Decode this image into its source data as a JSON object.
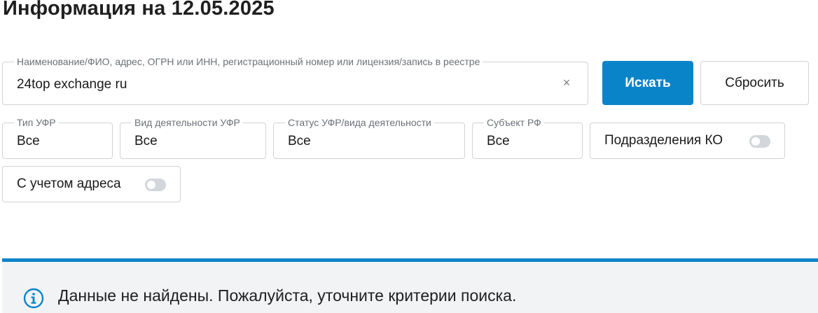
{
  "page": {
    "title": "Информация на 12.05.2025"
  },
  "search": {
    "label": "Наименование/ФИО, адрес, ОГРН или ИНН, регистрационный номер или лицензия/запись в реестре",
    "value": "24top exchange ru",
    "clear_symbol": "×",
    "search_button": "Искать",
    "reset_button": "Сбросить"
  },
  "filters": {
    "ufr_type": {
      "label": "Тип УФР",
      "value": "Все"
    },
    "activity": {
      "label": "Вид деятельности УФР",
      "value": "Все"
    },
    "status": {
      "label": "Статус УФР/вида деятельности",
      "value": "Все"
    },
    "region": {
      "label": "Субъект РФ",
      "value": "Все"
    }
  },
  "toggles": {
    "ko_divisions": {
      "label": "Подразделения КО",
      "on": false
    },
    "with_address": {
      "label": "С учетом адреса",
      "on": false
    }
  },
  "notice": {
    "icon": "info-icon",
    "text": "Данные не найдены. Пожалуйста, уточните критерии поиска."
  },
  "colors": {
    "accent": "#0a84c9",
    "notice_bg": "#f2f3f5",
    "border": "#cfd3d8"
  }
}
